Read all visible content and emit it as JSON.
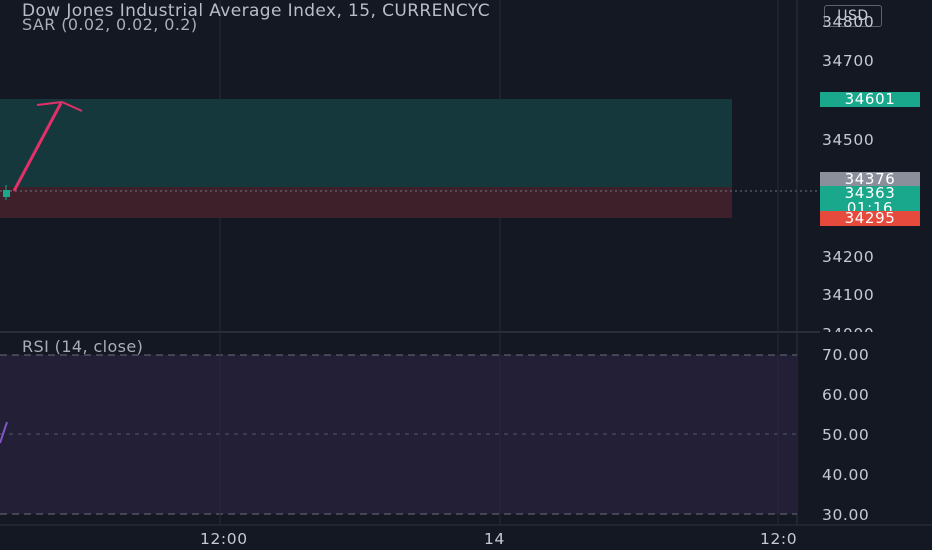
{
  "header": {
    "title": "Dow Jones Industrial Average Index, 15, CURRENCYC",
    "indicator": "SAR (0.02, 0.02, 0.2)",
    "currency": "USD"
  },
  "rsi_pane": {
    "title": "RSI (14, close)"
  },
  "colors": {
    "background": "#141823",
    "profit_zone": "#15383c",
    "loss_zone": "#3d2029",
    "arrow": "#e3306b",
    "rsi_band": "#231f37",
    "rsi_line": "#7e57c2",
    "tag_green": "#1aa88d",
    "tag_red": "#e64a3c",
    "tag_gray": "#8b8f9b"
  },
  "price_tags": {
    "take_profit": "34601",
    "entry": "34376",
    "last_price": "34363",
    "countdown": "01:16",
    "stop_loss": "34295"
  },
  "chart_data": [
    {
      "type": "line",
      "title": "Dow Jones Industrial Average Index, 15, CURRENCYC",
      "indicator": "SAR (0.02, 0.02, 0.2)",
      "y_ticks": [
        "34800",
        "34700",
        "34500",
        "34200",
        "34100",
        "34000"
      ],
      "ylim": [
        34000,
        34800
      ],
      "x_ticks": [
        {
          "label": "12:00",
          "pos": 0.28
        },
        {
          "label": "14",
          "pos": 0.62
        },
        {
          "label": "12:0",
          "pos": 0.985
        }
      ],
      "long_position": {
        "entry": 34376,
        "take_profit": 34601,
        "stop_loss": 34295
      },
      "last_price": 34363,
      "countdown": "01:16"
    },
    {
      "type": "line",
      "title": "RSI (14, close)",
      "y_ticks": [
        "70.00",
        "60.00",
        "50.00",
        "40.00",
        "30.00"
      ],
      "ylim": [
        30,
        70
      ],
      "band": [
        30,
        70
      ],
      "series": [
        {
          "values": [
            45,
            53
          ]
        }
      ]
    }
  ]
}
